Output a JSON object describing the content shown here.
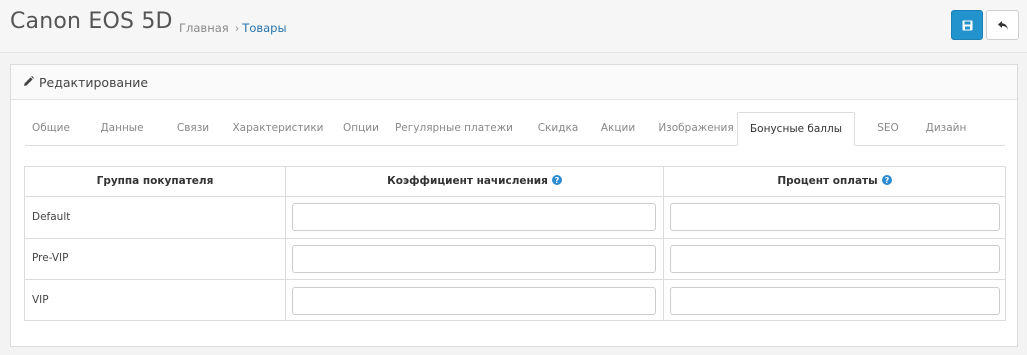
{
  "header": {
    "title": "Canon EOS 5D",
    "breadcrumb": {
      "home": "Главная",
      "separator": "›",
      "current": "Товары"
    },
    "save_icon": "save-floppy-icon",
    "back_icon": "reply-back-icon",
    "colors": {
      "primary": "#2393ce",
      "link": "#2a75ac"
    }
  },
  "panel": {
    "icon": "pencil-icon",
    "title": "Редактирование"
  },
  "tabs": [
    {
      "label": "Общие"
    },
    {
      "label": "Данные"
    },
    {
      "label": "Связи"
    },
    {
      "label": "Характеристики"
    },
    {
      "label": "Опции"
    },
    {
      "label": "Регулярные платежи"
    },
    {
      "label": "Скидка"
    },
    {
      "label": "Акции"
    },
    {
      "label": "Изображения"
    },
    {
      "label": "Бонусные баллы",
      "active": true
    },
    {
      "label": "SEO"
    },
    {
      "label": "Дизайн"
    }
  ],
  "table": {
    "headers": {
      "group": "Группа покупателя",
      "coefficient": "Коэффициент начисления",
      "percent": "Процент оплаты"
    },
    "help_icon": "question-circle-icon",
    "rows": [
      {
        "group": "Default",
        "coefficient": "",
        "percent": ""
      },
      {
        "group": "Pre-VIP",
        "coefficient": "",
        "percent": ""
      },
      {
        "group": "VIP",
        "coefficient": "",
        "percent": ""
      }
    ]
  }
}
